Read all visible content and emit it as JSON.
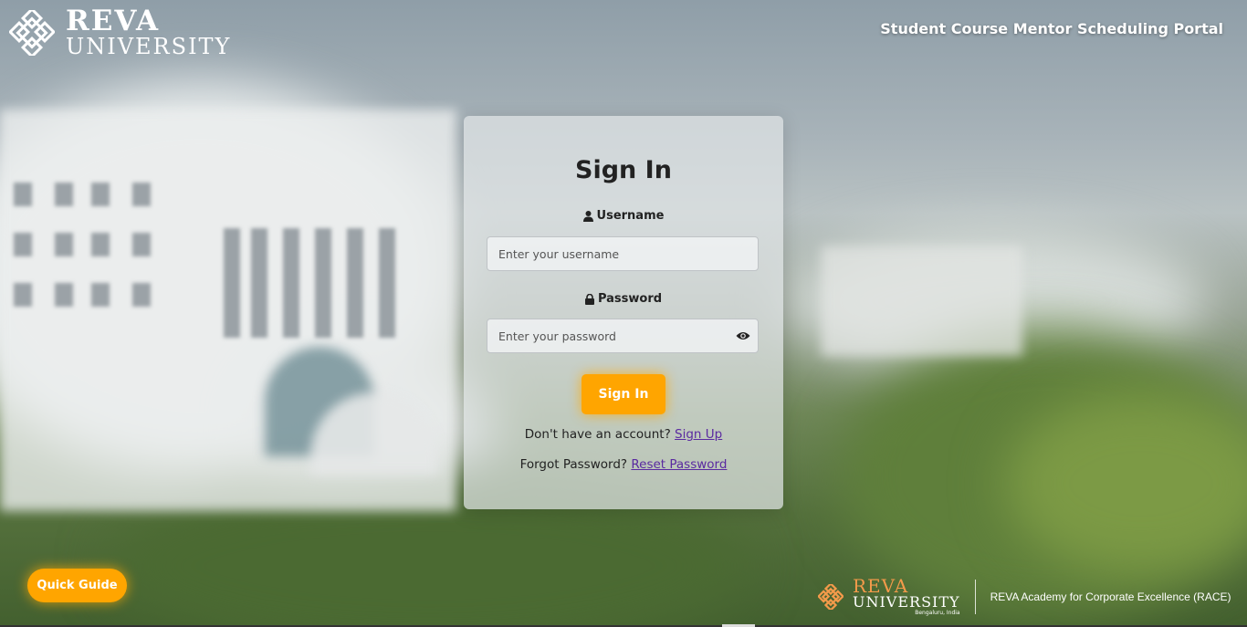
{
  "header": {
    "logo": {
      "line1": "REVA",
      "line2": "UNIVERSITY",
      "icon": "reva-logo-icon"
    },
    "portal_title": "Student Course Mentor Scheduling Portal"
  },
  "login_card": {
    "title": "Sign In",
    "username": {
      "label": "Username",
      "icon": "user-icon",
      "placeholder": "Enter your username",
      "value": ""
    },
    "password": {
      "label": "Password",
      "icon": "lock-icon",
      "placeholder": "Enter your password",
      "value": "",
      "toggle_icon": "eye-icon"
    },
    "submit_label": "Sign In",
    "signup_prompt": "Don't have an account?",
    "signup_link": "Sign Up",
    "forgot_prompt": "Forgot Password?",
    "reset_link": "Reset Password"
  },
  "quick_guide_label": "Quick Guide",
  "footer": {
    "logo_line1": "REVA",
    "logo_line2": "UNIVERSITY",
    "logo_location": "Bengaluru, India",
    "race_text": "REVA Academy for Corporate Excellence (RACE)"
  },
  "colors": {
    "accent": "#ffa500",
    "link": "#5a2aa0",
    "footer_logo_orange": "#f39a4a"
  }
}
